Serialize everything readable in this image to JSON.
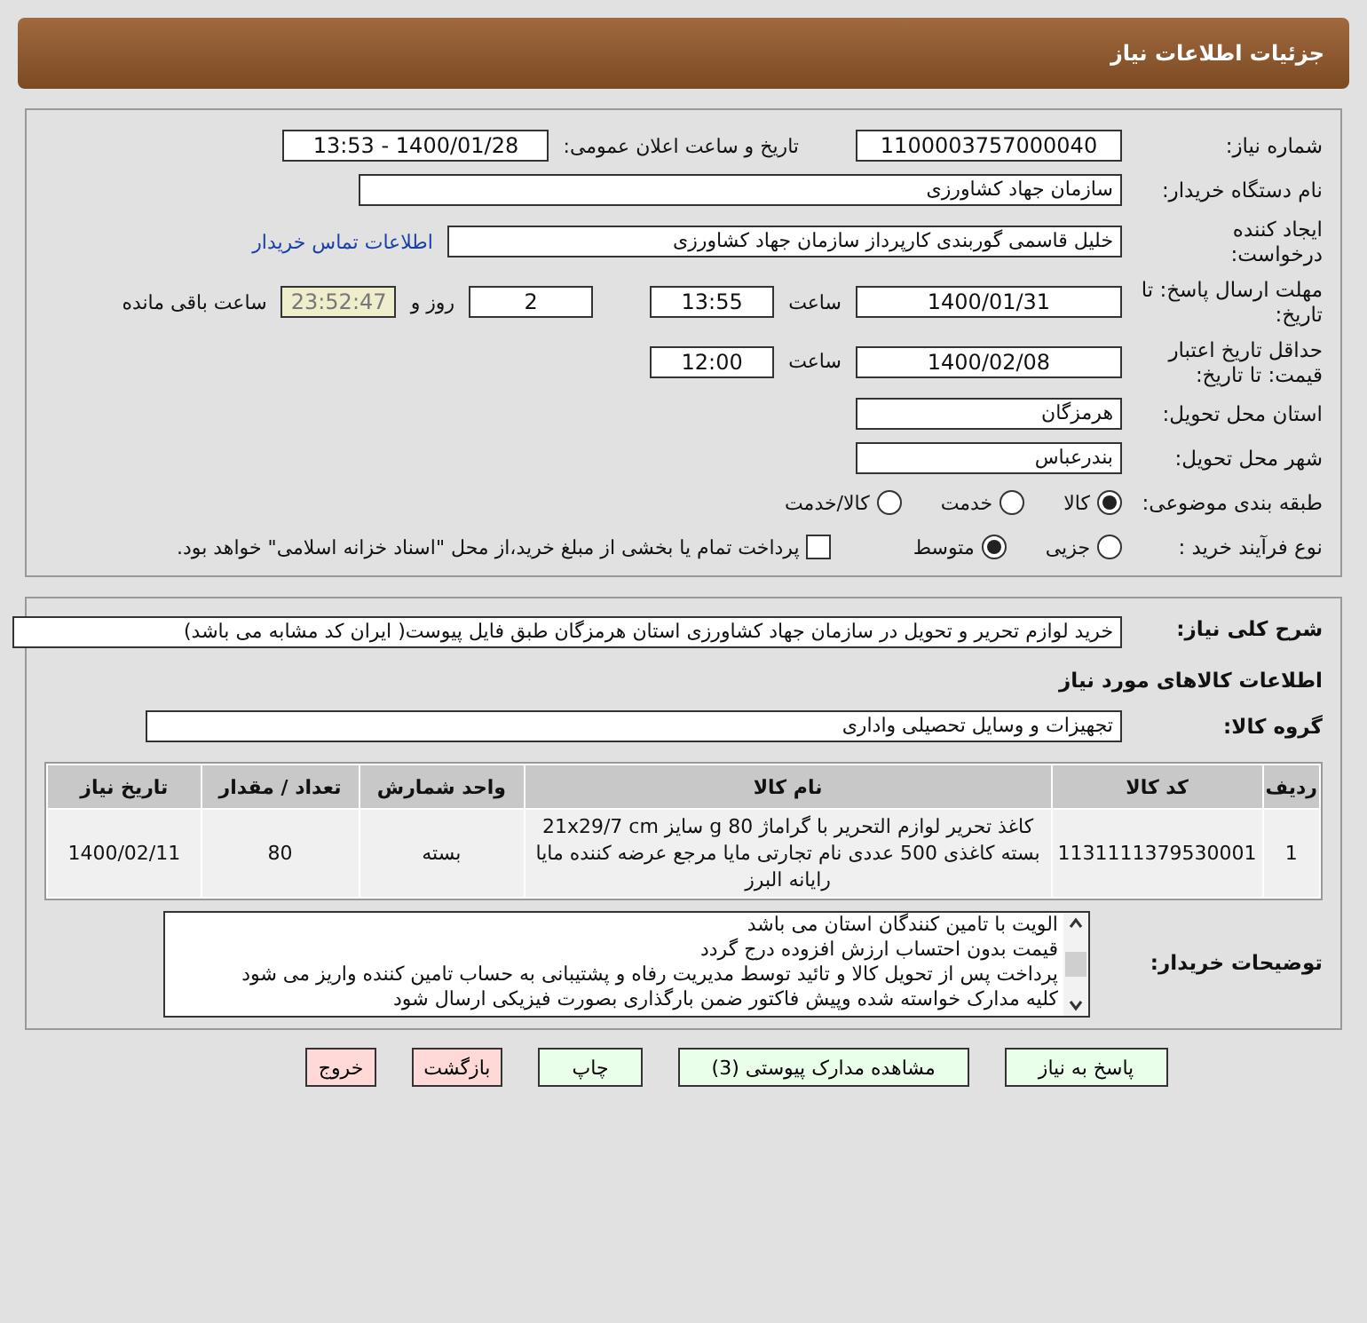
{
  "header": {
    "title": "جزئیات اطلاعات نیاز"
  },
  "request": {
    "need_number": {
      "label": "شماره نیاز:",
      "value": "1100003757000040"
    },
    "announce": {
      "label": "تاریخ و ساعت اعلان عمومی:",
      "value": "1400/01/28 - 13:53"
    },
    "buyer_org": {
      "label": "نام دستگاه خریدار:",
      "value": "سازمان جهاد کشاورزی"
    },
    "creator": {
      "label": "ایجاد کننده درخواست:",
      "value": "خلیل قاسمی گوربندی کارپرداز سازمان جهاد کشاورزی",
      "link": "اطلاعات تماس خریدار"
    },
    "deadline": {
      "label": "مهلت ارسال پاسخ: تا تاریخ:",
      "date": "1400/01/31",
      "time_label": "ساعت",
      "time": "13:55",
      "days": "2",
      "days_label": "روز و",
      "remaining": "23:52:47",
      "remaining_label": "ساعت باقی مانده"
    },
    "validity": {
      "label": "حداقل تاریخ اعتبار قیمت: تا تاریخ:",
      "date": "1400/02/08",
      "time_label": "ساعت",
      "time": "12:00"
    },
    "province": {
      "label": "استان محل تحویل:",
      "value": "هرمزگان"
    },
    "city": {
      "label": "شهر محل تحویل:",
      "value": "بندرعباس"
    },
    "category": {
      "label": "طبقه بندی موضوعی:",
      "options": [
        {
          "label": "کالا",
          "selected": true
        },
        {
          "label": "خدمت",
          "selected": false
        },
        {
          "label": "کالا/خدمت",
          "selected": false
        }
      ]
    },
    "process": {
      "label": "نوع فرآیند خرید :",
      "options": [
        {
          "label": "جزیی",
          "selected": false
        },
        {
          "label": "متوسط",
          "selected": true
        }
      ],
      "treasury": {
        "checked": false,
        "label": "پرداخت تمام یا بخشی از مبلغ خرید،از محل \"اسناد خزانه اسلامی\" خواهد بود."
      }
    }
  },
  "details": {
    "description": {
      "label": "شرح کلی نیاز:",
      "value": "خرید لوازم تحریر و تحویل در سازمان جهاد کشاورزی استان هرمزگان طبق فایل پیوست( ایران کد مشابه می باشد)"
    },
    "goods_title": "اطلاعات کالاهای مورد نیاز",
    "goods_group": {
      "label": "گروه کالا:",
      "value": "تجهیزات و وسایل تحصیلی واداری"
    },
    "table": {
      "columns": [
        "ردیف",
        "کد کالا",
        "نام کالا",
        "واحد شمارش",
        "تعداد / مقدار",
        "تاریخ نیاز"
      ],
      "rows": [
        [
          "1",
          "1131111379530001",
          "کاغذ تحریر لوازم التحریر با گراماژ 80 g سایز 21x29/7 cm بسته کاغذی 500 عددی نام تجارتی مایا مرجع عرضه کننده مایا رایانه البرز",
          "بسته",
          "80",
          "1400/02/11"
        ]
      ]
    },
    "buyer_notes": {
      "label": "توضیحات خریدار:",
      "lines": [
        "الویت با تامین کنندگان استان می باشد",
        "قیمت بدون احتساب ارزش افزوده درج گردد",
        "پرداخت پس از تحویل کالا و تائید توسط مدیریت رفاه و پشتیبانی به حساب تامین کننده واریز می شود",
        "کلیه مدارک خواسته شده وپیش فاکتور ضمن بارگذاری بصورت فیزیکی ارسال شود"
      ]
    }
  },
  "buttons": [
    {
      "label": "پاسخ به نیاز",
      "kind": "normal"
    },
    {
      "label": "مشاهده مدارک پیوستی (3)",
      "kind": "normal"
    },
    {
      "label": "چاپ",
      "kind": "normal"
    },
    {
      "label": "بازگشت",
      "kind": "danger"
    },
    {
      "label": "خروج",
      "kind": "danger"
    }
  ]
}
